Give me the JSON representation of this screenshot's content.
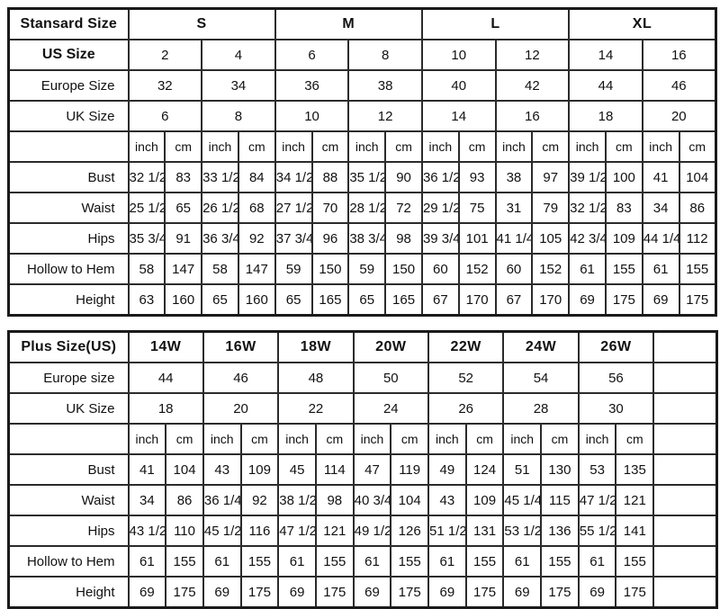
{
  "standard_table": {
    "corner_label": "Stansard Size",
    "size_groups": [
      {
        "label": "S",
        "span": 4
      },
      {
        "label": "M",
        "span": 4
      },
      {
        "label": "L",
        "span": 4
      },
      {
        "label": "XL",
        "span": 4
      }
    ],
    "rows": [
      {
        "label": "US Size",
        "bold": true,
        "values": [
          "2",
          "4",
          "6",
          "8",
          "10",
          "12",
          "14",
          "16"
        ]
      },
      {
        "label": "Europe Size",
        "bold": false,
        "values": [
          "32",
          "34",
          "36",
          "38",
          "40",
          "42",
          "44",
          "46"
        ]
      },
      {
        "label": "UK Size",
        "bold": false,
        "values": [
          "6",
          "8",
          "10",
          "12",
          "14",
          "16",
          "18",
          "20"
        ]
      }
    ],
    "unit_row": {
      "label": "",
      "units": [
        "inch",
        "cm",
        "inch",
        "cm",
        "inch",
        "cm",
        "inch",
        "cm",
        "inch",
        "cm",
        "inch",
        "cm",
        "inch",
        "cm",
        "inch",
        "cm"
      ]
    },
    "measure_rows": [
      {
        "label": "Bust",
        "values": [
          "32 1/2",
          "83",
          "33 1/2",
          "84",
          "34 1/2",
          "88",
          "35 1/2",
          "90",
          "36 1/2",
          "93",
          "38",
          "97",
          "39 1/2",
          "100",
          "41",
          "104"
        ]
      },
      {
        "label": "Waist",
        "values": [
          "25 1/2",
          "65",
          "26 1/2",
          "68",
          "27 1/2",
          "70",
          "28 1/2",
          "72",
          "29 1/2",
          "75",
          "31",
          "79",
          "32 1/2",
          "83",
          "34",
          "86"
        ]
      },
      {
        "label": "Hips",
        "values": [
          "35 3/4",
          "91",
          "36 3/4",
          "92",
          "37 3/4",
          "96",
          "38 3/4",
          "98",
          "39 3/4",
          "101",
          "41 1/4",
          "105",
          "42 3/4",
          "109",
          "44 1/4",
          "112"
        ]
      },
      {
        "label": "Hollow to Hem",
        "values": [
          "58",
          "147",
          "58",
          "147",
          "59",
          "150",
          "59",
          "150",
          "60",
          "152",
          "60",
          "152",
          "61",
          "155",
          "61",
          "155"
        ]
      },
      {
        "label": "Height",
        "values": [
          "63",
          "160",
          "65",
          "160",
          "65",
          "165",
          "65",
          "165",
          "67",
          "170",
          "67",
          "170",
          "69",
          "175",
          "69",
          "175"
        ]
      }
    ]
  },
  "plus_table": {
    "corner_label": "Plus Size(US)",
    "size_groups": [
      {
        "label": "14W",
        "span": 2
      },
      {
        "label": "16W",
        "span": 2
      },
      {
        "label": "18W",
        "span": 2
      },
      {
        "label": "20W",
        "span": 2
      },
      {
        "label": "22W",
        "span": 2
      },
      {
        "label": "24W",
        "span": 2
      },
      {
        "label": "26W",
        "span": 2
      }
    ],
    "rows": [
      {
        "label": "Europe size",
        "bold": false,
        "values": [
          "44",
          "46",
          "48",
          "50",
          "52",
          "54",
          "56"
        ]
      },
      {
        "label": "UK Size",
        "bold": false,
        "values": [
          "18",
          "20",
          "22",
          "24",
          "26",
          "28",
          "30"
        ]
      }
    ],
    "unit_row": {
      "label": "",
      "units": [
        "inch",
        "cm",
        "inch",
        "cm",
        "inch",
        "cm",
        "inch",
        "cm",
        "inch",
        "cm",
        "inch",
        "cm",
        "inch",
        "cm"
      ]
    },
    "measure_rows": [
      {
        "label": "Bust",
        "values": [
          "41",
          "104",
          "43",
          "109",
          "45",
          "114",
          "47",
          "119",
          "49",
          "124",
          "51",
          "130",
          "53",
          "135"
        ]
      },
      {
        "label": "Waist",
        "values": [
          "34",
          "86",
          "36 1/4",
          "92",
          "38 1/2",
          "98",
          "40 3/4",
          "104",
          "43",
          "109",
          "45 1/4",
          "115",
          "47 1/2",
          "121"
        ]
      },
      {
        "label": "Hips",
        "values": [
          "43 1/2",
          "110",
          "45 1/2",
          "116",
          "47 1/2",
          "121",
          "49 1/2",
          "126",
          "51 1/2",
          "131",
          "53 1/2",
          "136",
          "55 1/2",
          "141"
        ]
      },
      {
        "label": "Hollow to Hem",
        "values": [
          "61",
          "155",
          "61",
          "155",
          "61",
          "155",
          "61",
          "155",
          "61",
          "155",
          "61",
          "155",
          "61",
          "155"
        ]
      },
      {
        "label": "Height",
        "values": [
          "69",
          "175",
          "69",
          "175",
          "69",
          "175",
          "69",
          "175",
          "69",
          "175",
          "69",
          "175",
          "69",
          "175"
        ]
      }
    ]
  },
  "colors": {
    "border": "#2b2b2b",
    "outer_border": "#1a1a1a",
    "background": "#ffffff",
    "text": "#111111"
  }
}
